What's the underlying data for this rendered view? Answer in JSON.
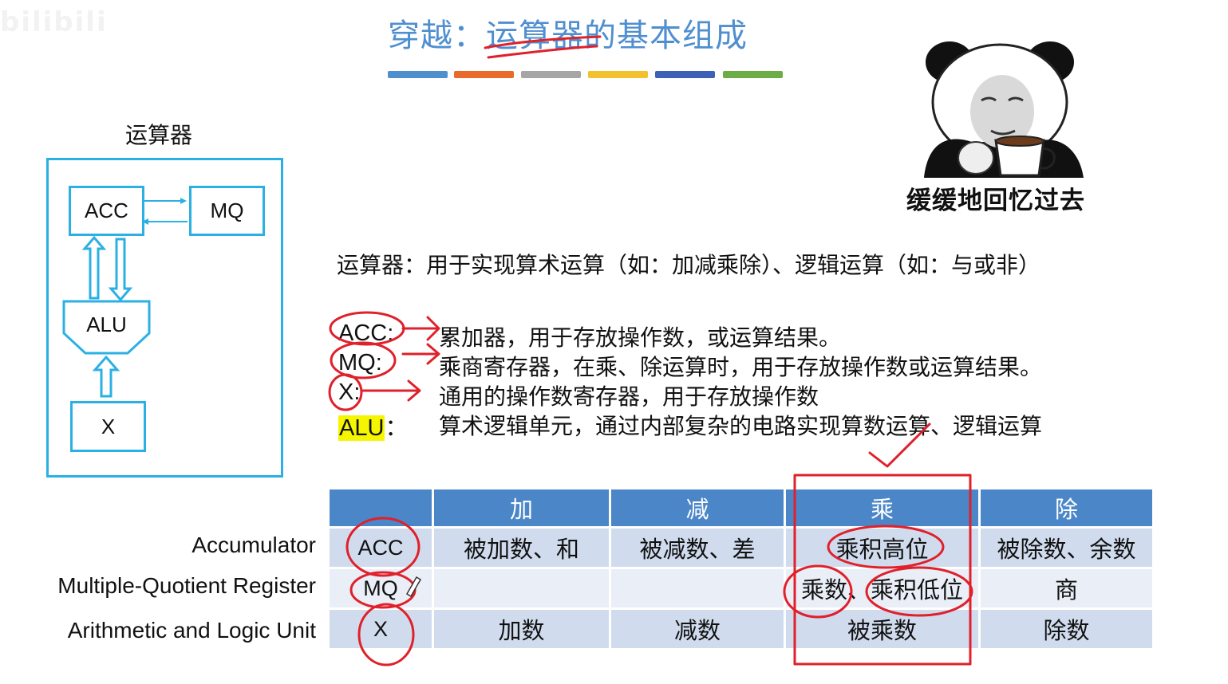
{
  "watermark": "bilibili",
  "title": {
    "part1": "穿越：",
    "part2": "运算器的基本组成"
  },
  "color_bars": [
    "#4f8fd0",
    "#e86b2c",
    "#a6a6a6",
    "#f2c12e",
    "#3c62b8",
    "#6dad46"
  ],
  "diagram": {
    "caption": "运算器",
    "acc": "ACC",
    "mq": "MQ",
    "alu": "ALU",
    "x": "X"
  },
  "meme": {
    "caption": "缓缓地回忆过去"
  },
  "definition": "运算器：用于实现算术运算（如：加减乘除）、逻辑运算（如：与或非）",
  "registers": [
    {
      "term": "ACC:",
      "desc": "累加器，用于存放操作数，或运算结果。"
    },
    {
      "term": "MQ:",
      "desc": "乘商寄存器，在乘、除运算时，用于存放操作数或运算结果。"
    },
    {
      "term": "X:",
      "desc": "通用的操作数寄存器，用于存放操作数"
    },
    {
      "term": "ALU",
      "term_suffix": "：",
      "desc": "算术逻辑单元，通过内部复杂的电路实现算数运算、逻辑运算"
    }
  ],
  "table": {
    "headers": [
      "",
      "加",
      "减",
      "乘",
      "除"
    ],
    "rows": [
      {
        "label": "Accumulator",
        "reg": "ACC",
        "add": "被加数、和",
        "sub": "被减数、差",
        "mul": "乘积高位",
        "div": "被除数、余数"
      },
      {
        "label": "Multiple-Quotient Register",
        "reg": "MQ",
        "add": "",
        "sub": "",
        "mul": "乘数、乘积低位",
        "div": "商"
      },
      {
        "label": "Arithmetic and Logic Unit",
        "reg": "X",
        "add": "加数",
        "sub": "减数",
        "mul": "被乘数",
        "div": "除数"
      }
    ]
  },
  "colors": {
    "accent": "#2bb0e4",
    "title": "#4f8fd0",
    "ink": "#e0202a",
    "table_header": "#4a86c8"
  }
}
